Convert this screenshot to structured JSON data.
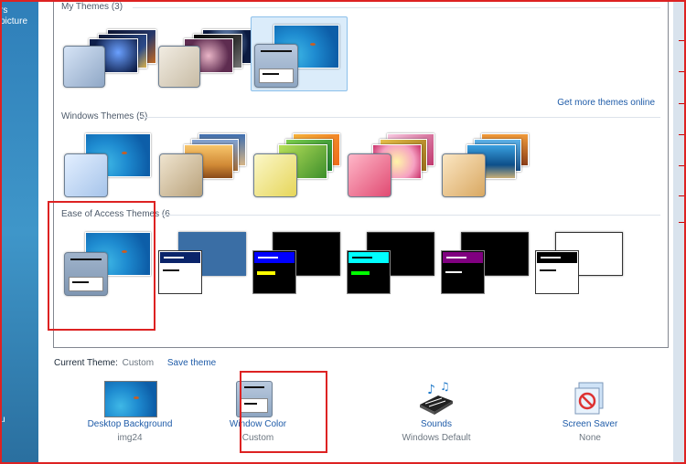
{
  "left_nav": {
    "items": [
      "rs",
      "picture",
      "u"
    ]
  },
  "groups": {
    "my_themes": {
      "title": "My Themes (3)",
      "tile_count": 3,
      "selected_index": 2
    },
    "windows_themes": {
      "title": "Windows Themes (5)",
      "tile_count": 5
    },
    "ease_of_access": {
      "title": "Ease of Access Themes (6",
      "tile_count": 6
    }
  },
  "get_more_link": "Get more themes online",
  "current_theme": {
    "label": "Current Theme:",
    "value": "Custom",
    "save_link": "Save theme"
  },
  "settings": [
    {
      "name": "Desktop Background",
      "value": "img24",
      "icon": "desktop-background-icon"
    },
    {
      "name": "Window Color",
      "value": "Custom",
      "icon": "window-color-icon"
    },
    {
      "name": "Sounds",
      "value": "Windows Default",
      "icon": "sounds-icon"
    },
    {
      "name": "Screen Saver",
      "value": "None",
      "icon": "screen-saver-icon"
    }
  ],
  "colors": {
    "accent_link": "#1e5ba8",
    "annotation_red": "#dd2222",
    "selected_tile": "#dbecfa"
  }
}
